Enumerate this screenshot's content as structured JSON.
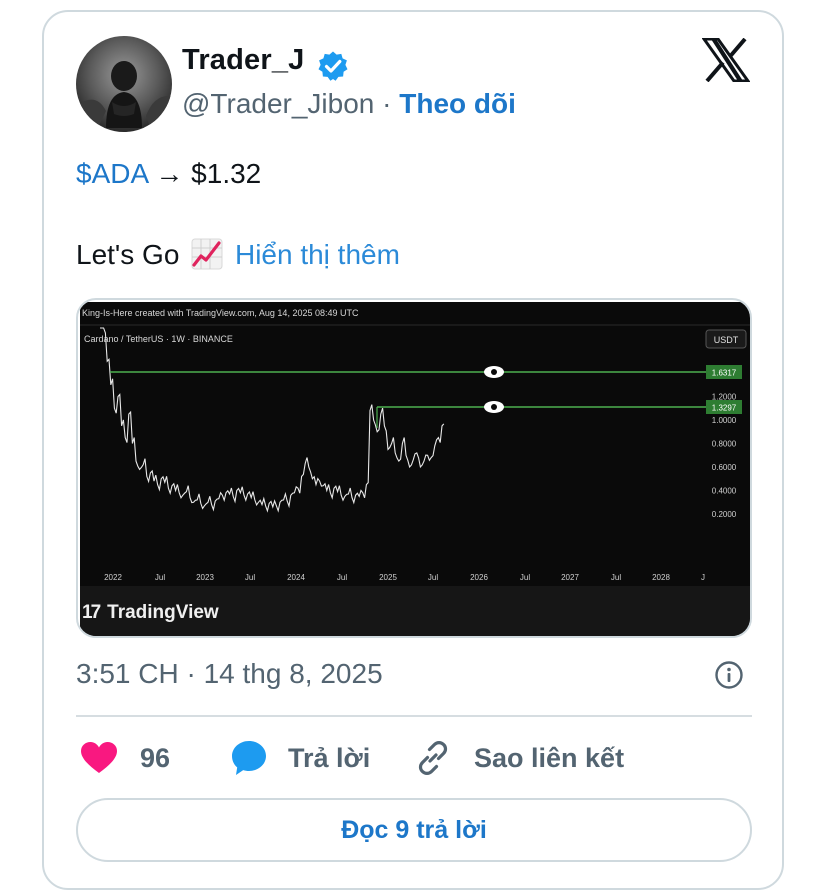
{
  "tweet": {
    "author_name": "Trader_J",
    "handle": "@Trader_Jibon",
    "separator": "·",
    "follow_label": "Theo dõi",
    "cashtag": "$ADA",
    "price_text": "→ $1.32",
    "line2_text": "Let's Go",
    "show_more_label": "Hiển thị thêm",
    "timestamp": "3:51 CH · 14 thg 8, 2025",
    "likes": "96",
    "reply_label": "Trả lời",
    "copy_link_label": "Sao liên kết",
    "read_replies_label": "Đọc 9 trả lời"
  },
  "chart": {
    "header_text": "King-Is-Here created with TradingView.com, Aug 14, 2025 08:49 UTC",
    "symbol_text": "Cardano / TetherUS · 1W · BINANCE",
    "currency_label": "USDT",
    "brand_label": "TradingView",
    "colors": {
      "background": "#0a0a0a",
      "price_line": "#e8e8e8",
      "level_line": "#4caf50"
    }
  },
  "chart_data": {
    "type": "line",
    "x_tick_labels": [
      "2022",
      "Jul",
      "2023",
      "Jul",
      "2024",
      "Jul",
      "2025",
      "Jul",
      "2026",
      "Jul",
      "2027",
      "Jul",
      "2028",
      "J"
    ],
    "y_tick_labels": [
      "1.2000",
      "1.0000",
      "0.8000",
      "0.6000",
      "0.4000",
      "0.2000"
    ],
    "level_labels": [
      "1.6317",
      "1.3297"
    ],
    "levels": [
      1.6317,
      1.3297
    ],
    "series": [
      {
        "values": [
          2.4,
          1.9,
          1.5,
          1.3,
          1.1,
          1.2,
          0.95,
          0.85,
          1.05,
          0.8,
          0.65,
          0.58,
          0.62,
          0.52,
          0.55,
          0.48,
          0.45,
          0.5,
          0.47,
          0.42,
          0.44,
          0.4,
          0.38,
          0.36,
          0.39,
          0.34,
          0.3,
          0.32,
          0.29,
          0.27,
          0.3,
          0.28,
          0.31,
          0.33,
          0.36,
          0.38,
          0.37,
          0.35,
          0.4,
          0.38,
          0.36,
          0.37,
          0.34,
          0.32,
          0.3,
          0.28,
          0.27,
          0.29,
          0.26,
          0.27,
          0.3,
          0.32,
          0.31,
          0.36,
          0.38,
          0.42,
          0.52,
          0.63,
          0.6,
          0.5,
          0.45,
          0.48,
          0.44,
          0.4,
          0.38,
          0.42,
          0.39,
          0.36,
          0.35,
          0.37,
          0.34,
          0.36,
          0.35,
          0.38,
          0.45,
          1.08,
          1.0,
          0.9,
          1.05,
          0.95,
          0.75,
          0.8,
          0.72,
          0.65,
          0.8,
          0.7,
          0.6,
          0.66,
          0.72,
          0.6,
          0.65,
          0.7,
          0.68,
          0.78,
          0.85,
          0.95
        ]
      }
    ]
  }
}
